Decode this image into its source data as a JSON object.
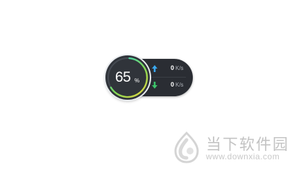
{
  "widget": {
    "usage_value": "65",
    "usage_unit": "%",
    "usage_fraction": 0.65,
    "upload": {
      "value": "0",
      "unit": "K/s",
      "icon": "arrow-up-icon",
      "color": "#3aa8f0"
    },
    "download": {
      "value": "0",
      "unit": "K/s",
      "icon": "arrow-down-icon",
      "color": "#3cc46a"
    },
    "ring_colors": [
      "#2bd3e0",
      "#7ed957",
      "#f0d83c"
    ]
  },
  "watermark": {
    "title": "当下软件园",
    "url": "www.downxia.com",
    "logo_icon": "downxia-logo-icon"
  }
}
